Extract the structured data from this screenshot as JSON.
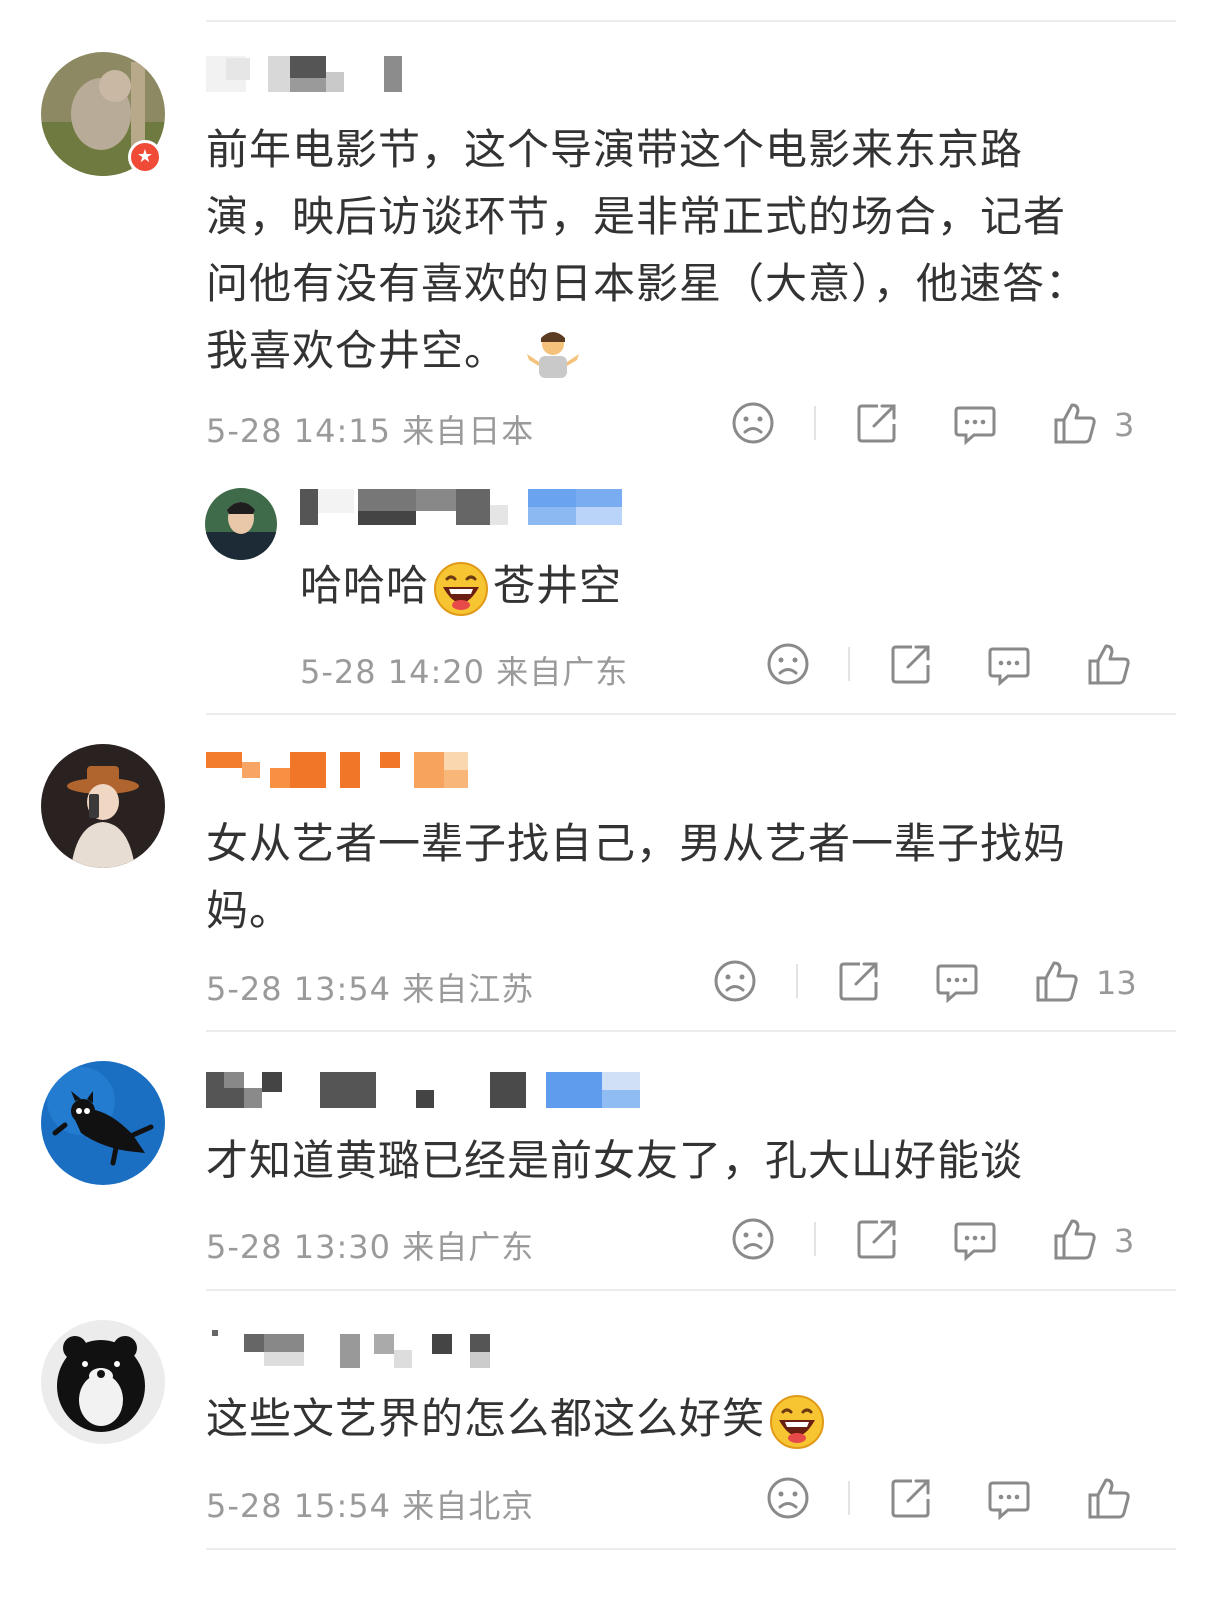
{
  "comments": [
    {
      "text": "前年电影节，这个导演带这个电影来东京路演，映后访谈环节，是非常正式的场合，记者问他有没有喜欢的日本影星（大意），他速答：我喜欢仓井空。",
      "emoji": "shrug-emoji",
      "meta": "5-28 14:15 来自日本",
      "likes": "3",
      "reply": {
        "text": "哈哈哈",
        "text_after": "苍井空",
        "emoji": "laughing-emoji",
        "meta": "5-28 14:20 来自广东",
        "likes": ""
      }
    },
    {
      "text": "女从艺者一辈子找自己，男从艺者一辈子找妈妈。",
      "meta": "5-28 13:54 来自江苏",
      "likes": "13"
    },
    {
      "text": "才知道黄璐已经是前女友了，孔大山好能谈",
      "meta": "5-28 13:30 来自广东",
      "likes": "3"
    },
    {
      "text": "这些文艺界的怎么都这么好笑",
      "emoji": "laughing-emoji",
      "meta": "5-28 15:54 来自北京",
      "likes": ""
    }
  ],
  "icons": {
    "dislike": "frown-face-icon",
    "share": "share-icon",
    "reply": "comment-bubble-icon",
    "like": "thumbs-up-icon"
  },
  "colors": {
    "text": "#333333",
    "meta": "#9a9a9a",
    "divider": "#ececec",
    "badge": "#f04b36"
  }
}
